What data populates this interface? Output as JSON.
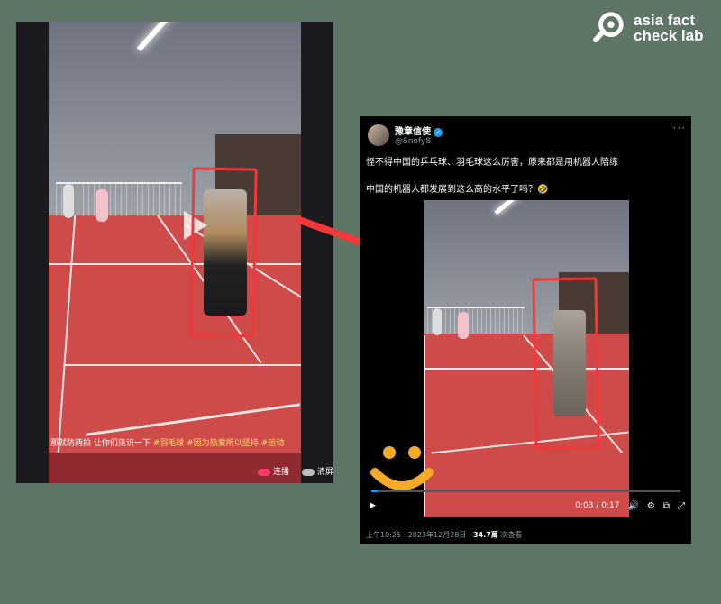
{
  "logo": {
    "line1": "asia fact",
    "line2": "check lab"
  },
  "left_video": {
    "caption_text": "那就防两拍 让你们见识一下",
    "hashtags": [
      "#羽毛球",
      "#因为热爱所以坚持",
      "#运动"
    ],
    "controls": [
      {
        "label": "连播",
        "on": true
      },
      {
        "label": "清屏",
        "on": false
      }
    ]
  },
  "tweet": {
    "display_name": "豫章信使",
    "handle": "@Snofy8",
    "more": "···",
    "text_line1": "怪不得中国的乒乓球、羽毛球这么厉害，原来都是用机器人陪练",
    "text_line2": "中国的机器人都发展到这么高的水平了吗？🤣",
    "video": {
      "time": "0:03 / 0:17",
      "progress": 0.02
    },
    "footer_time": "上午10:25 · 2023年12月28日 · ",
    "views": "34.7萬",
    "views_suffix": " 次查看"
  },
  "colors": {
    "background": "#5f7566",
    "highlight": "#f03a3a",
    "accent": "#1d9bf0"
  }
}
